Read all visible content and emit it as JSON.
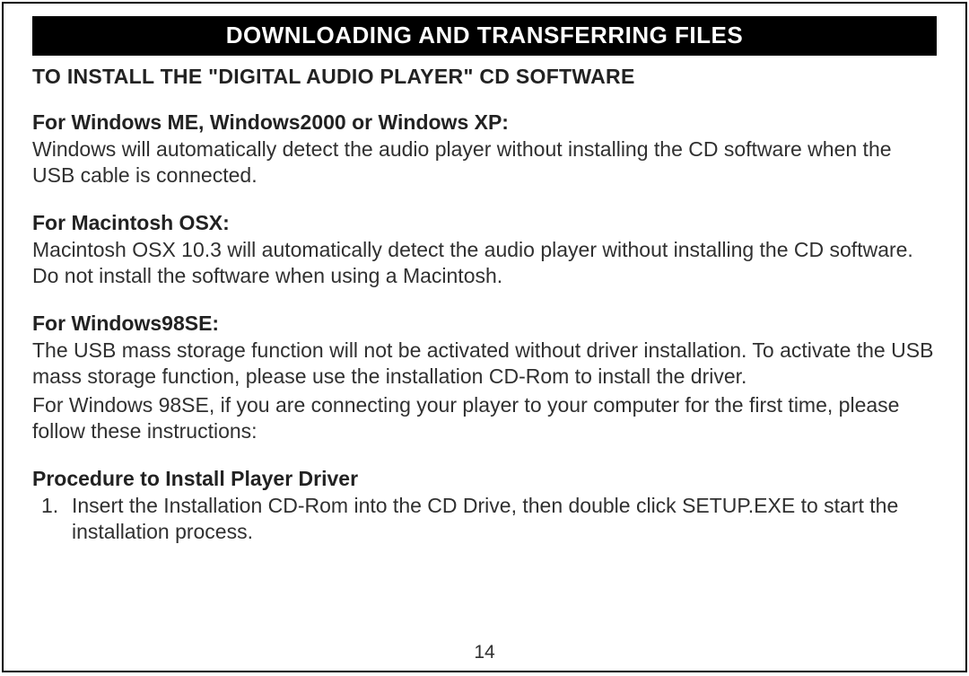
{
  "banner": "DOWNLOADING AND TRANSFERRING FILES",
  "subtitle": "TO INSTALL THE \"DIGITAL AUDIO PLAYER\" CD SOFTWARE",
  "sections": [
    {
      "heading": "For Windows ME, Windows2000 or Windows XP:",
      "body": "Windows will automatically detect the audio player without installing the CD software when the USB cable is connected."
    },
    {
      "heading": "For Macintosh OSX:",
      "body": "Macintosh OSX 10.3 will automatically detect the audio player without installing the CD software. Do not install the software when using a Macintosh."
    },
    {
      "heading": "For Windows98SE:",
      "body": "The USB mass storage function will not be activated without driver installation. To activate the USB mass storage function, please use the installation CD-Rom to install the driver.",
      "body2": "For Windows 98SE, if you are connecting your player to your computer for the first time, please follow these instructions:"
    }
  ],
  "procedure": {
    "heading": "Procedure to Install Player Driver",
    "steps": [
      "Insert the Installation CD-Rom into the CD Drive, then double click SETUP.EXE to start the installation process."
    ]
  },
  "page_number": "14"
}
